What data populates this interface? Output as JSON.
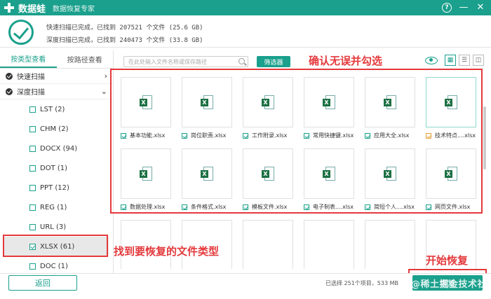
{
  "titlebar": {
    "app_name": "数据蛙",
    "subtitle": "数据恢复专家",
    "help": "?",
    "minimize": "—",
    "close": "✕"
  },
  "scan": {
    "quick": "快速扫描已完成，已找到 207521 个文件 (25.6 GB)",
    "deep": "深度扫描已完成，已找到 240473 个文件 (33.8 GB)"
  },
  "sidebar": {
    "tabs": [
      "按类型查看",
      "按路径查看"
    ],
    "groups": [
      "快速扫描",
      "深度扫描"
    ],
    "group_arrows": [
      "›",
      "⌄"
    ],
    "types": [
      {
        "label": "LST (2)",
        "checked": false
      },
      {
        "label": "CHM (2)",
        "checked": false
      },
      {
        "label": "DOCX (94)",
        "checked": false
      },
      {
        "label": "DOT (1)",
        "checked": false
      },
      {
        "label": "PPT (12)",
        "checked": false
      },
      {
        "label": "REG (1)",
        "checked": false
      },
      {
        "label": "URL (3)",
        "checked": false
      },
      {
        "label": "XLSX (61)",
        "checked": true
      },
      {
        "label": "DOC (1)",
        "checked": false
      }
    ]
  },
  "toolbar": {
    "search_placeholder": "在此处输入文件名称或保存路径",
    "filter_label": "筛选器",
    "view_icons": [
      "▦",
      "☰",
      "◫"
    ]
  },
  "files": [
    {
      "name": "基本功能.xlsx",
      "checked": true
    },
    {
      "name": "岗位职责.xlsx",
      "checked": true
    },
    {
      "name": "工作附录.xlsx",
      "checked": true
    },
    {
      "name": "常用快捷键.xlsx",
      "checked": true
    },
    {
      "name": "应用大全.xlsx",
      "checked": true
    },
    {
      "name": "技术特点....xlsx",
      "checked": true,
      "partial": true
    },
    {
      "name": "数据处理.xlsx",
      "checked": true
    },
    {
      "name": "条件格式.xlsx",
      "checked": true
    },
    {
      "name": "模板文件.xlsx",
      "checked": true
    },
    {
      "name": "电子制表....xlsx",
      "checked": true
    },
    {
      "name": "简短个人....xlsx",
      "checked": true
    },
    {
      "name": "网页文件.xlsx",
      "checked": true
    }
  ],
  "file_icon_letter": "X",
  "annotations": {
    "confirm": "确认无误并勾选",
    "find_type": "找到要恢复的文件类型",
    "start": "开始恢复"
  },
  "footer": {
    "back_label": "返回",
    "selected_info": "已选择 251个项目，533 MB",
    "start_label": "恢复",
    "watermark": "@稀土掘金技术社区"
  },
  "colors": {
    "accent": "#1aa08c",
    "annotation": "#e4393c"
  }
}
